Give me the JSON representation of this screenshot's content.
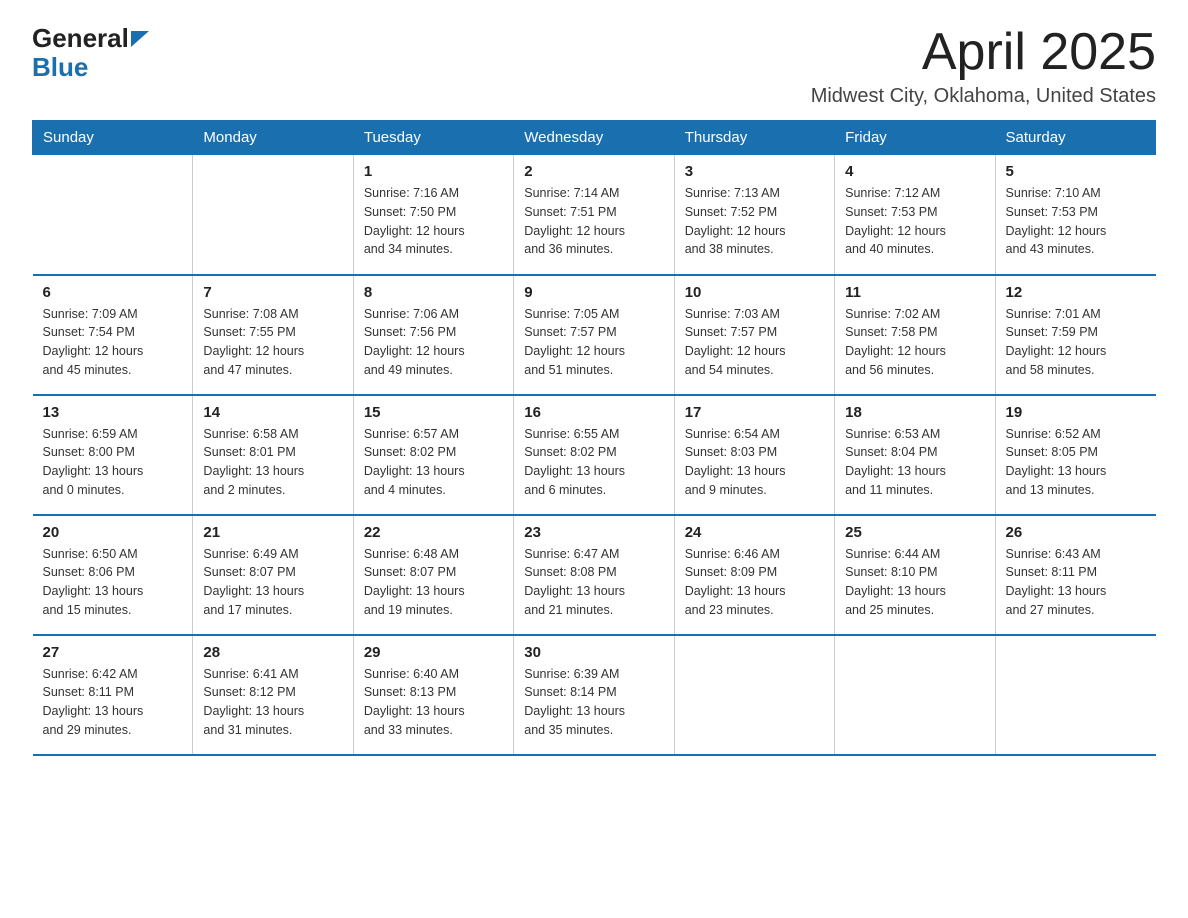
{
  "logo": {
    "general": "General",
    "blue": "Blue"
  },
  "title": "April 2025",
  "location": "Midwest City, Oklahoma, United States",
  "days_of_week": [
    "Sunday",
    "Monday",
    "Tuesday",
    "Wednesday",
    "Thursday",
    "Friday",
    "Saturday"
  ],
  "weeks": [
    [
      {
        "day": "",
        "info": ""
      },
      {
        "day": "",
        "info": ""
      },
      {
        "day": "1",
        "info": "Sunrise: 7:16 AM\nSunset: 7:50 PM\nDaylight: 12 hours\nand 34 minutes."
      },
      {
        "day": "2",
        "info": "Sunrise: 7:14 AM\nSunset: 7:51 PM\nDaylight: 12 hours\nand 36 minutes."
      },
      {
        "day": "3",
        "info": "Sunrise: 7:13 AM\nSunset: 7:52 PM\nDaylight: 12 hours\nand 38 minutes."
      },
      {
        "day": "4",
        "info": "Sunrise: 7:12 AM\nSunset: 7:53 PM\nDaylight: 12 hours\nand 40 minutes."
      },
      {
        "day": "5",
        "info": "Sunrise: 7:10 AM\nSunset: 7:53 PM\nDaylight: 12 hours\nand 43 minutes."
      }
    ],
    [
      {
        "day": "6",
        "info": "Sunrise: 7:09 AM\nSunset: 7:54 PM\nDaylight: 12 hours\nand 45 minutes."
      },
      {
        "day": "7",
        "info": "Sunrise: 7:08 AM\nSunset: 7:55 PM\nDaylight: 12 hours\nand 47 minutes."
      },
      {
        "day": "8",
        "info": "Sunrise: 7:06 AM\nSunset: 7:56 PM\nDaylight: 12 hours\nand 49 minutes."
      },
      {
        "day": "9",
        "info": "Sunrise: 7:05 AM\nSunset: 7:57 PM\nDaylight: 12 hours\nand 51 minutes."
      },
      {
        "day": "10",
        "info": "Sunrise: 7:03 AM\nSunset: 7:57 PM\nDaylight: 12 hours\nand 54 minutes."
      },
      {
        "day": "11",
        "info": "Sunrise: 7:02 AM\nSunset: 7:58 PM\nDaylight: 12 hours\nand 56 minutes."
      },
      {
        "day": "12",
        "info": "Sunrise: 7:01 AM\nSunset: 7:59 PM\nDaylight: 12 hours\nand 58 minutes."
      }
    ],
    [
      {
        "day": "13",
        "info": "Sunrise: 6:59 AM\nSunset: 8:00 PM\nDaylight: 13 hours\nand 0 minutes."
      },
      {
        "day": "14",
        "info": "Sunrise: 6:58 AM\nSunset: 8:01 PM\nDaylight: 13 hours\nand 2 minutes."
      },
      {
        "day": "15",
        "info": "Sunrise: 6:57 AM\nSunset: 8:02 PM\nDaylight: 13 hours\nand 4 minutes."
      },
      {
        "day": "16",
        "info": "Sunrise: 6:55 AM\nSunset: 8:02 PM\nDaylight: 13 hours\nand 6 minutes."
      },
      {
        "day": "17",
        "info": "Sunrise: 6:54 AM\nSunset: 8:03 PM\nDaylight: 13 hours\nand 9 minutes."
      },
      {
        "day": "18",
        "info": "Sunrise: 6:53 AM\nSunset: 8:04 PM\nDaylight: 13 hours\nand 11 minutes."
      },
      {
        "day": "19",
        "info": "Sunrise: 6:52 AM\nSunset: 8:05 PM\nDaylight: 13 hours\nand 13 minutes."
      }
    ],
    [
      {
        "day": "20",
        "info": "Sunrise: 6:50 AM\nSunset: 8:06 PM\nDaylight: 13 hours\nand 15 minutes."
      },
      {
        "day": "21",
        "info": "Sunrise: 6:49 AM\nSunset: 8:07 PM\nDaylight: 13 hours\nand 17 minutes."
      },
      {
        "day": "22",
        "info": "Sunrise: 6:48 AM\nSunset: 8:07 PM\nDaylight: 13 hours\nand 19 minutes."
      },
      {
        "day": "23",
        "info": "Sunrise: 6:47 AM\nSunset: 8:08 PM\nDaylight: 13 hours\nand 21 minutes."
      },
      {
        "day": "24",
        "info": "Sunrise: 6:46 AM\nSunset: 8:09 PM\nDaylight: 13 hours\nand 23 minutes."
      },
      {
        "day": "25",
        "info": "Sunrise: 6:44 AM\nSunset: 8:10 PM\nDaylight: 13 hours\nand 25 minutes."
      },
      {
        "day": "26",
        "info": "Sunrise: 6:43 AM\nSunset: 8:11 PM\nDaylight: 13 hours\nand 27 minutes."
      }
    ],
    [
      {
        "day": "27",
        "info": "Sunrise: 6:42 AM\nSunset: 8:11 PM\nDaylight: 13 hours\nand 29 minutes."
      },
      {
        "day": "28",
        "info": "Sunrise: 6:41 AM\nSunset: 8:12 PM\nDaylight: 13 hours\nand 31 minutes."
      },
      {
        "day": "29",
        "info": "Sunrise: 6:40 AM\nSunset: 8:13 PM\nDaylight: 13 hours\nand 33 minutes."
      },
      {
        "day": "30",
        "info": "Sunrise: 6:39 AM\nSunset: 8:14 PM\nDaylight: 13 hours\nand 35 minutes."
      },
      {
        "day": "",
        "info": ""
      },
      {
        "day": "",
        "info": ""
      },
      {
        "day": "",
        "info": ""
      }
    ]
  ]
}
